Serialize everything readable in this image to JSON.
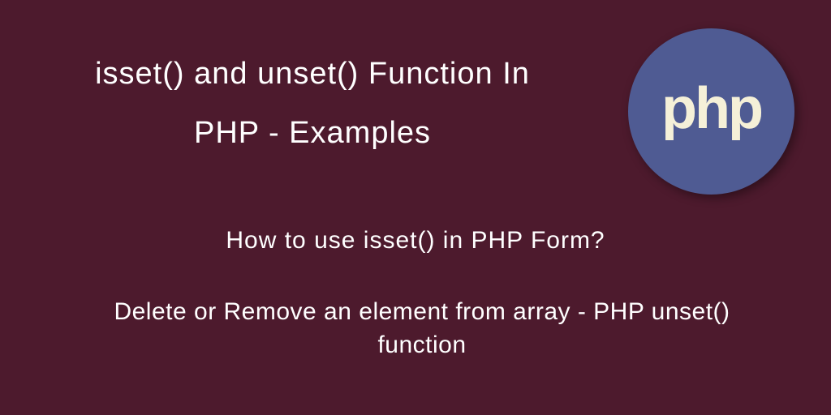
{
  "title": {
    "line1": "isset() and unset() Function In",
    "line2": "PHP - Examples"
  },
  "subtitles": {
    "first": "How to use isset() in PHP Form?",
    "second": "Delete or Remove an element from array - PHP unset() function"
  },
  "logo": {
    "text": "php"
  }
}
